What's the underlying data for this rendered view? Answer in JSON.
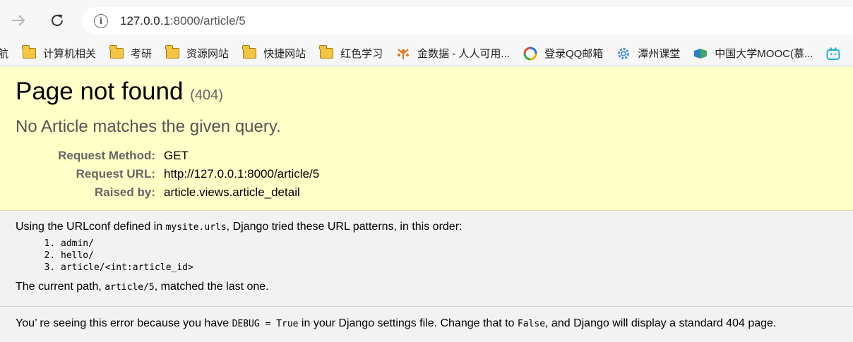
{
  "browser": {
    "url_host": "127.0.0.1",
    "url_rest": ":8000/article/5"
  },
  "bookmarks": [
    {
      "label": "航",
      "icon": "none"
    },
    {
      "label": "计算机相关",
      "icon": "folder-icon"
    },
    {
      "label": "考研",
      "icon": "folder-icon"
    },
    {
      "label": "资源网站",
      "icon": "folder-icon"
    },
    {
      "label": "快捷网站",
      "icon": "folder-icon"
    },
    {
      "label": "红色学习",
      "icon": "folder-icon"
    },
    {
      "label": "金数据 - 人人可用...",
      "icon": "jinshuju-icon"
    },
    {
      "label": "登录QQ邮箱",
      "icon": "qq-mail-icon"
    },
    {
      "label": "潭州课堂",
      "icon": "gear-icon"
    },
    {
      "label": "中国大学MOOC(慕...",
      "icon": "mooc-icon"
    },
    {
      "label": "",
      "icon": "bilibili-icon"
    }
  ],
  "summary": {
    "title": "Page not found",
    "status_code": "(404)",
    "message": "No Article matches the given query.",
    "meta": [
      {
        "label": "Request Method:",
        "value": "GET"
      },
      {
        "label": "Request URL:",
        "value": "http://127.0.0.1:8000/article/5"
      },
      {
        "label": "Raised by:",
        "value": "article.views.article_detail"
      }
    ]
  },
  "info": {
    "intro_prefix": "Using the URLconf defined in ",
    "urlconf": "mysite.urls",
    "intro_suffix": ", Django tried these URL patterns, in this order:",
    "patterns": [
      "admin/",
      "hello/",
      "article/<int:article_id>"
    ],
    "current_prefix": "The current path, ",
    "current_path": "article/5",
    "current_suffix": ", matched the last one."
  },
  "explanation": {
    "part1": "You’ re seeing this error because you have ",
    "debug_code": "DEBUG = True",
    "part2": " in your Django settings file. Change that to ",
    "false_code": "False",
    "part3": ", and Django will display a standard 404 page."
  }
}
